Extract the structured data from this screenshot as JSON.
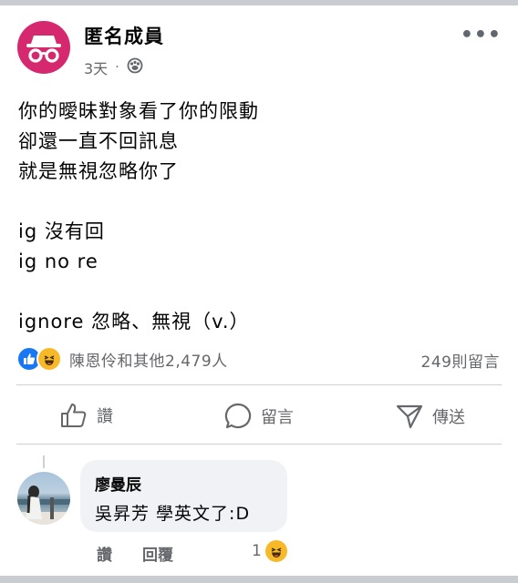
{
  "post": {
    "author": "匿名成員",
    "time": "3天",
    "separator": "·",
    "more": "•••",
    "lines": [
      "你的曖昧對象看了你的限動",
      "卻還一直不回訊息",
      "就是無視忽略你了",
      "",
      "ig 沒有回",
      "ig no re",
      "",
      "ignore 忽略、無視（v.）"
    ]
  },
  "reactions": {
    "names": "陳恩伶和其他2,479人",
    "comments_count": "249則留言"
  },
  "actions": {
    "like": "讚",
    "comment": "留言",
    "share": "傳送"
  },
  "comment": {
    "author": "廖曼辰",
    "text": "吳昇芳 學英文了:D",
    "like_label": "讚",
    "reply_label": "回覆",
    "reaction_count": "1"
  }
}
